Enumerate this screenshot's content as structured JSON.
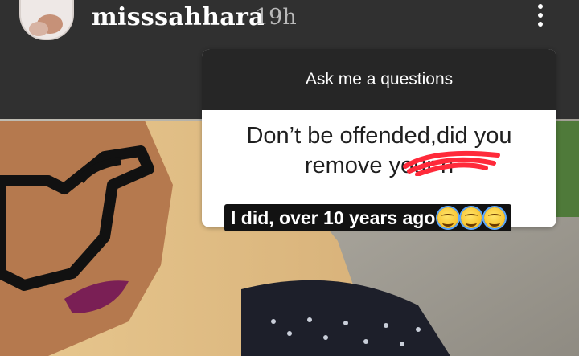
{
  "story": {
    "username": "misssahhara",
    "time_ago": "19h",
    "menu_icon": "more-vertical-icon",
    "avatar_icon": "profile-avatar"
  },
  "question_sticker": {
    "header": "Ask me a questions",
    "question": "Don’t be offended,did you remove your n",
    "scribble_color": "#ff2a3a"
  },
  "answer": {
    "text": "I did, over 10 years ago",
    "emoji": "smiling-face-with-halo"
  },
  "colors": {
    "topbar": "#303030",
    "sticker_header": "#262626",
    "sticker_body": "#ffffff",
    "answer_bg": "#121212"
  }
}
